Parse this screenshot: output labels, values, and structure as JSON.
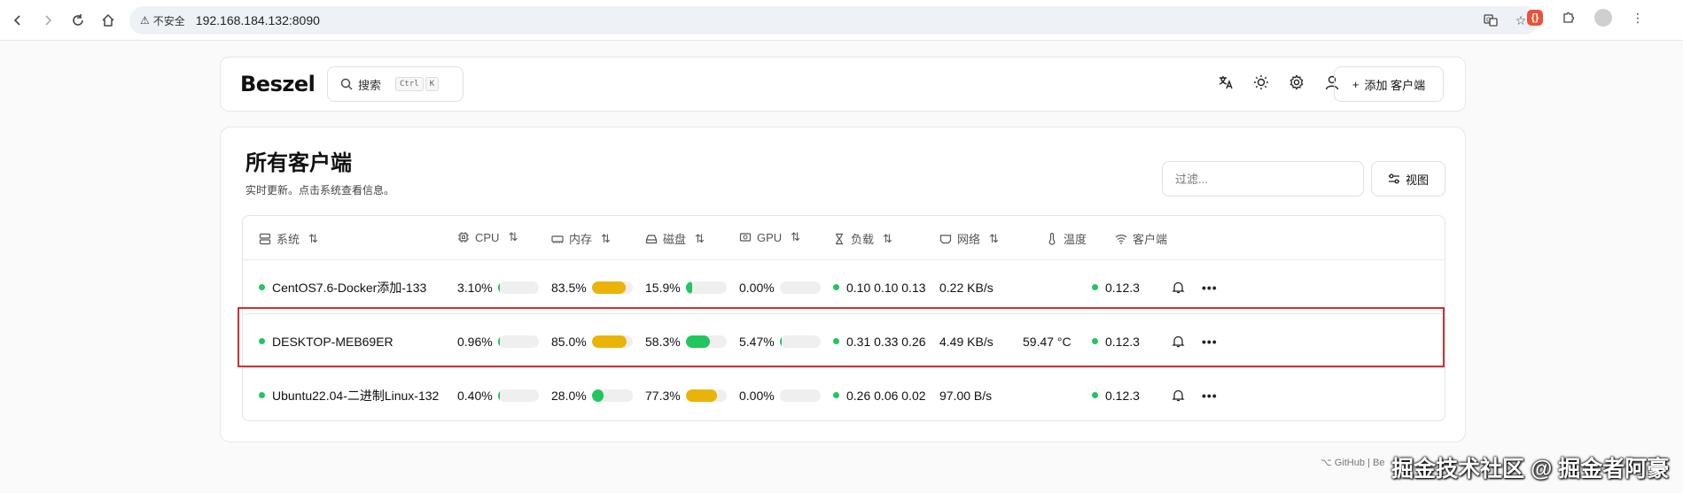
{
  "browser": {
    "insecure_label": "不安全",
    "url": "192.168.184.132:8090"
  },
  "header": {
    "logo": "Beszel",
    "search_label": "搜索",
    "kbd_ctrl": "Ctrl",
    "kbd_k": "K",
    "add_client_label": "添加 客户端"
  },
  "main": {
    "title": "所有客户端",
    "subtitle": "实时更新。点击系统查看信息。",
    "filter_placeholder": "过滤...",
    "view_label": "视图"
  },
  "columns": [
    {
      "label": "系统",
      "icon": "server-icon"
    },
    {
      "label": "CPU",
      "icon": "cpu-icon"
    },
    {
      "label": "内存",
      "icon": "memory-icon"
    },
    {
      "label": "磁盘",
      "icon": "disk-icon"
    },
    {
      "label": "GPU",
      "icon": "gpu-icon"
    },
    {
      "label": "负载",
      "icon": "hourglass-icon"
    },
    {
      "label": "网络",
      "icon": "network-icon"
    },
    {
      "label": "温度",
      "icon": "thermometer-icon"
    },
    {
      "label": "客户端",
      "icon": "wifi-icon"
    }
  ],
  "rows": [
    {
      "name": "CentOS7.6-Docker添加-133",
      "cpu": "3.10%",
      "cpu_pct": 3.1,
      "mem": "83.5%",
      "mem_pct": 83.5,
      "disk": "15.9%",
      "disk_pct": 15.9,
      "gpu": "0.00%",
      "gpu_pct": 0,
      "load": "0.10 0.10 0.13",
      "net": "0.22 KB/s",
      "temp": "",
      "agent": "0.12.3"
    },
    {
      "name": "DESKTOP-MEB69ER",
      "cpu": "0.96%",
      "cpu_pct": 0.96,
      "mem": "85.0%",
      "mem_pct": 85.0,
      "disk": "58.3%",
      "disk_pct": 58.3,
      "gpu": "5.47%",
      "gpu_pct": 5.47,
      "load": "0.31 0.33 0.26",
      "net": "4.49 KB/s",
      "temp": "59.47 °C",
      "agent": "0.12.3"
    },
    {
      "name": "Ubuntu22.04-二进制Linux-132",
      "cpu": "0.40%",
      "cpu_pct": 0.4,
      "mem": "28.0%",
      "mem_pct": 28.0,
      "disk": "77.3%",
      "disk_pct": 77.3,
      "gpu": "0.00%",
      "gpu_pct": 0,
      "load": "0.26 0.06 0.02",
      "net": "97.00 B/s",
      "temp": "",
      "agent": "0.12.3"
    }
  ],
  "colors": {
    "green": "#22c55e",
    "yellow": "#eab308",
    "highlight": "#d32f2f"
  },
  "footer": {
    "github": "GitHub",
    "sep": "|",
    "partial": "Be"
  },
  "watermark": "掘金技术社区 @ 掘金者阿豪"
}
